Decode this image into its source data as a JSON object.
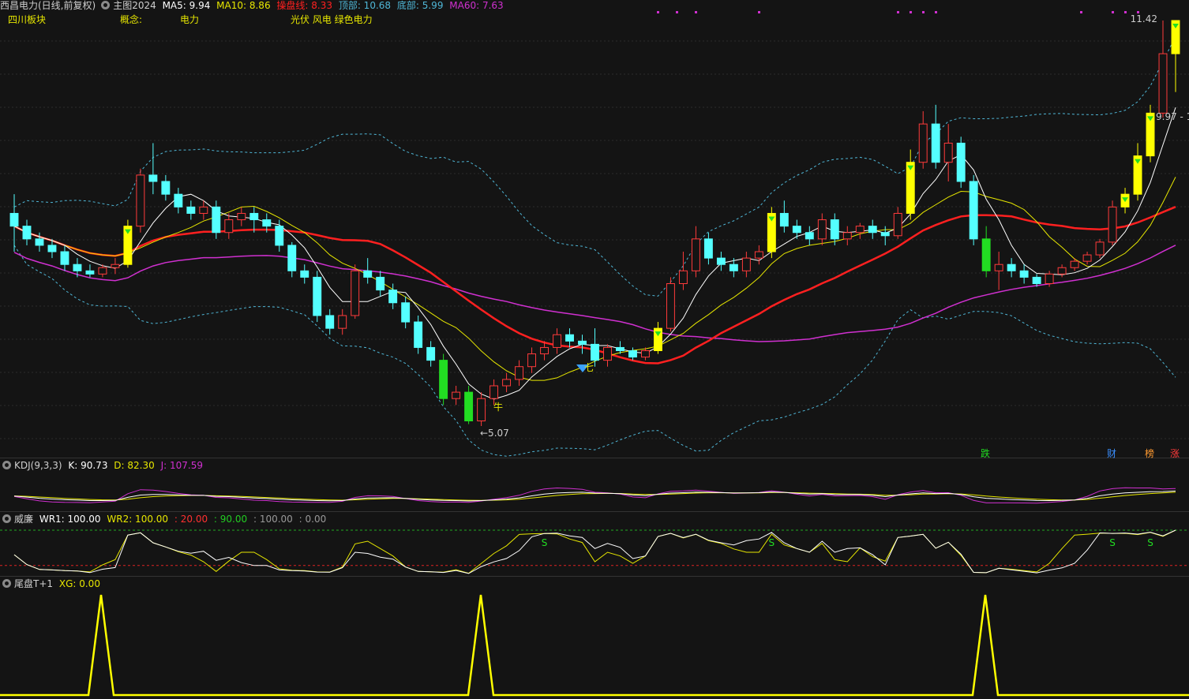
{
  "header": {
    "stock": "西昌电力(日线,前复权)",
    "indicator": "主图2024",
    "ma5": "MA5: 9.94",
    "ma10": "MA10: 8.86",
    "cost": "操盘线: 8.33",
    "top": "顶部: 10.68",
    "bottom": "底部: 5.99",
    "ma60": "MA60: 7.63"
  },
  "concepts": {
    "sector": "四川板块",
    "concept_label": "概念:",
    "concept1": "电力",
    "concept2": "光伏 风电 绿色电力"
  },
  "annotations": {
    "high": "11.42",
    "low": "←5.07",
    "last": "9.97 - 1",
    "niu": "牛",
    "qi": "七"
  },
  "event_tags": {
    "die": "跌",
    "cai": "财",
    "bang": "榜",
    "zhang": "涨"
  },
  "kdj": {
    "title": "KDJ(9,3,3)",
    "k": "K: 90.73",
    "d": "D: 82.30",
    "j": "J: 107.59"
  },
  "wr": {
    "title": "威廉",
    "wr1": "WR1: 100.00",
    "wr2": "WR2: 100.00",
    "l20": ": 20.00",
    "l90": ": 90.00",
    "l100": ": 100.00",
    "l0": ": 0.00"
  },
  "tail": {
    "title": "尾盘T+1",
    "xg": "XG: 0.00"
  },
  "colors": {
    "up": "#ff3b3b",
    "down": "#54ffff",
    "yellow": "#ffff00",
    "ma5": "#ffffff",
    "ma10": "#e6e600",
    "cost": "#ff2020",
    "ma60": "#d030d0",
    "band": "#4fb6d6",
    "green": "#22dd22"
  },
  "chart_data": {
    "type": "candlestick",
    "y_axis": {
      "min": 5.07,
      "max": 11.42
    },
    "candles": [
      [
        8.4,
        8.7,
        7.8,
        8.2
      ],
      [
        8.2,
        8.3,
        7.9,
        8.0
      ],
      [
        8.0,
        8.1,
        7.8,
        7.9
      ],
      [
        7.9,
        8.0,
        7.7,
        7.8
      ],
      [
        7.8,
        7.9,
        7.5,
        7.6
      ],
      [
        7.6,
        7.7,
        7.4,
        7.5
      ],
      [
        7.5,
        7.6,
        7.4,
        7.45
      ],
      [
        7.45,
        7.6,
        7.4,
        7.55
      ],
      [
        7.55,
        7.7,
        7.45,
        7.6
      ],
      [
        7.6,
        8.3,
        7.55,
        8.2
      ],
      [
        8.2,
        9.1,
        8.1,
        9.0
      ],
      [
        9.0,
        9.5,
        8.7,
        8.9
      ],
      [
        8.9,
        9.0,
        8.6,
        8.7
      ],
      [
        8.7,
        8.8,
        8.4,
        8.5
      ],
      [
        8.5,
        8.6,
        8.3,
        8.4
      ],
      [
        8.4,
        8.6,
        8.3,
        8.5
      ],
      [
        8.5,
        8.6,
        8.0,
        8.1
      ],
      [
        8.1,
        8.4,
        8.0,
        8.3
      ],
      [
        8.3,
        8.5,
        8.2,
        8.4
      ],
      [
        8.4,
        8.5,
        8.1,
        8.3
      ],
      [
        8.3,
        8.4,
        8.1,
        8.2
      ],
      [
        8.2,
        8.3,
        7.8,
        7.9
      ],
      [
        7.9,
        7.95,
        7.4,
        7.5
      ],
      [
        7.5,
        7.6,
        7.3,
        7.4
      ],
      [
        7.4,
        7.5,
        6.7,
        6.8
      ],
      [
        6.8,
        6.9,
        6.5,
        6.6
      ],
      [
        6.6,
        6.9,
        6.5,
        6.8
      ],
      [
        6.8,
        7.6,
        6.75,
        7.5
      ],
      [
        7.5,
        7.7,
        7.3,
        7.4
      ],
      [
        7.4,
        7.5,
        7.1,
        7.2
      ],
      [
        7.2,
        7.3,
        6.9,
        7.0
      ],
      [
        7.0,
        7.1,
        6.6,
        6.7
      ],
      [
        6.7,
        6.8,
        6.2,
        6.3
      ],
      [
        6.3,
        6.4,
        6.0,
        6.1
      ],
      [
        6.1,
        6.2,
        5.4,
        5.5
      ],
      [
        5.5,
        5.7,
        5.4,
        5.6
      ],
      [
        5.6,
        5.7,
        5.1,
        5.15
      ],
      [
        5.15,
        5.6,
        5.07,
        5.5
      ],
      [
        5.5,
        5.8,
        5.4,
        5.7
      ],
      [
        5.7,
        5.9,
        5.6,
        5.8
      ],
      [
        5.8,
        6.1,
        5.7,
        6.0
      ],
      [
        6.0,
        6.3,
        5.9,
        6.2
      ],
      [
        6.2,
        6.4,
        6.1,
        6.3
      ],
      [
        6.3,
        6.6,
        6.2,
        6.5
      ],
      [
        6.5,
        6.6,
        6.3,
        6.4
      ],
      [
        6.4,
        6.5,
        6.2,
        6.35
      ],
      [
        6.35,
        6.6,
        6.0,
        6.1
      ],
      [
        6.1,
        6.35,
        6.0,
        6.3
      ],
      [
        6.3,
        6.4,
        6.2,
        6.25
      ],
      [
        6.25,
        6.3,
        6.1,
        6.15
      ],
      [
        6.15,
        6.3,
        6.1,
        6.25
      ],
      [
        6.25,
        6.7,
        6.2,
        6.6
      ],
      [
        6.6,
        7.4,
        6.55,
        7.3
      ],
      [
        7.3,
        7.8,
        7.2,
        7.5
      ],
      [
        7.5,
        8.2,
        7.4,
        8.0
      ],
      [
        8.0,
        8.1,
        7.6,
        7.7
      ],
      [
        7.7,
        7.8,
        7.5,
        7.6
      ],
      [
        7.6,
        7.7,
        7.4,
        7.5
      ],
      [
        7.5,
        7.8,
        7.4,
        7.7
      ],
      [
        7.7,
        7.9,
        7.6,
        7.8
      ],
      [
        7.8,
        8.5,
        7.7,
        8.4
      ],
      [
        8.4,
        8.6,
        8.1,
        8.2
      ],
      [
        8.2,
        8.3,
        8.0,
        8.1
      ],
      [
        8.1,
        8.2,
        7.9,
        8.0
      ],
      [
        8.0,
        8.4,
        7.9,
        8.3
      ],
      [
        8.3,
        8.4,
        7.9,
        8.0
      ],
      [
        8.0,
        8.2,
        7.9,
        8.1
      ],
      [
        8.1,
        8.25,
        8.0,
        8.2
      ],
      [
        8.2,
        8.3,
        8.0,
        8.1
      ],
      [
        8.1,
        8.2,
        7.9,
        8.05
      ],
      [
        8.05,
        8.5,
        8.0,
        8.4
      ],
      [
        8.4,
        9.4,
        8.3,
        9.2
      ],
      [
        9.2,
        10.0,
        9.1,
        9.8
      ],
      [
        9.8,
        10.1,
        9.1,
        9.2
      ],
      [
        9.2,
        9.8,
        8.9,
        9.5
      ],
      [
        9.5,
        9.6,
        8.8,
        8.9
      ],
      [
        8.9,
        9.0,
        7.9,
        8.0
      ],
      [
        8.0,
        8.2,
        7.4,
        7.5
      ],
      [
        7.5,
        7.8,
        7.2,
        7.6
      ],
      [
        7.6,
        7.7,
        7.4,
        7.5
      ],
      [
        7.5,
        7.6,
        7.3,
        7.4
      ],
      [
        7.4,
        7.45,
        7.25,
        7.3
      ],
      [
        7.3,
        7.5,
        7.25,
        7.45
      ],
      [
        7.45,
        7.6,
        7.4,
        7.55
      ],
      [
        7.55,
        7.7,
        7.5,
        7.65
      ],
      [
        7.65,
        7.8,
        7.6,
        7.75
      ],
      [
        7.75,
        8.0,
        7.7,
        7.95
      ],
      [
        7.95,
        8.6,
        7.9,
        8.5
      ],
      [
        8.5,
        8.8,
        8.4,
        8.7
      ],
      [
        8.7,
        9.5,
        8.6,
        9.3
      ],
      [
        9.3,
        10.1,
        9.2,
        9.97
      ],
      [
        9.97,
        11.42,
        9.9,
        10.9
      ],
      [
        10.9,
        11.42,
        10.3,
        11.42
      ]
    ],
    "limit_up_days": [
      9,
      51,
      60,
      71,
      88,
      89,
      90,
      92
    ],
    "limit_down_days": [
      34,
      36,
      77
    ]
  }
}
